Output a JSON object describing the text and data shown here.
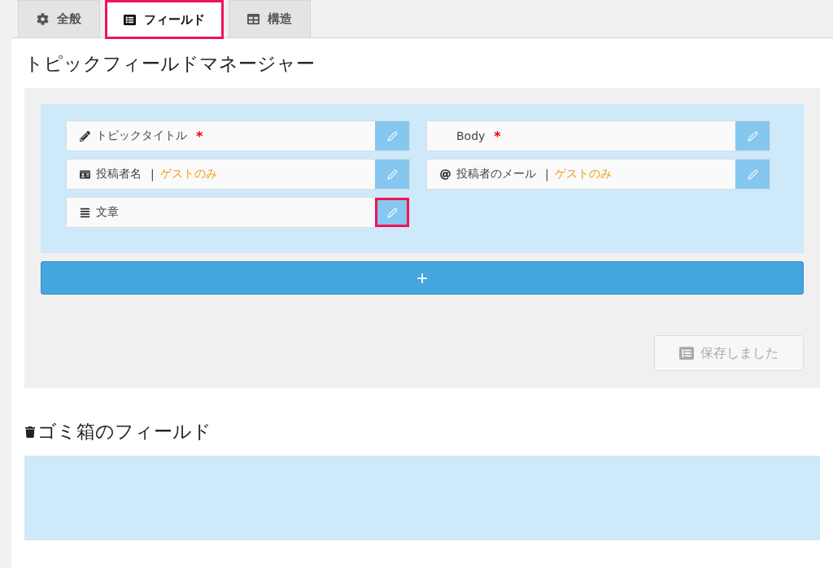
{
  "tabs": [
    {
      "label": "全般",
      "kind": "gear",
      "selected": false,
      "highlighted": false
    },
    {
      "label": "フィールド",
      "kind": "list",
      "selected": true,
      "highlighted": true
    },
    {
      "label": "構造",
      "kind": "table",
      "selected": false,
      "highlighted": false
    }
  ],
  "manager": {
    "title": "トピックフィールドマネージャー",
    "fields": [
      {
        "kind": "pencil",
        "label": "トピックタイトル",
        "required_mark": "*",
        "edit_highlighted": false
      },
      {
        "kind": "plain",
        "label": "Body",
        "required_mark": "*",
        "edit_highlighted": false
      },
      {
        "kind": "idcard",
        "label": "投稿者名",
        "separator": "|",
        "note": "ゲストのみ",
        "edit_highlighted": false
      },
      {
        "kind": "at",
        "label": "投稿者のメール",
        "separator": "|",
        "note": "ゲストのみ",
        "edit_highlighted": false
      },
      {
        "kind": "lines",
        "label": "文章",
        "edit_highlighted": true
      }
    ],
    "add_button": "+",
    "save_button": {
      "label": "保存しました",
      "disabled": true
    }
  },
  "trash": {
    "title": "ゴミ箱のフィールド"
  }
}
